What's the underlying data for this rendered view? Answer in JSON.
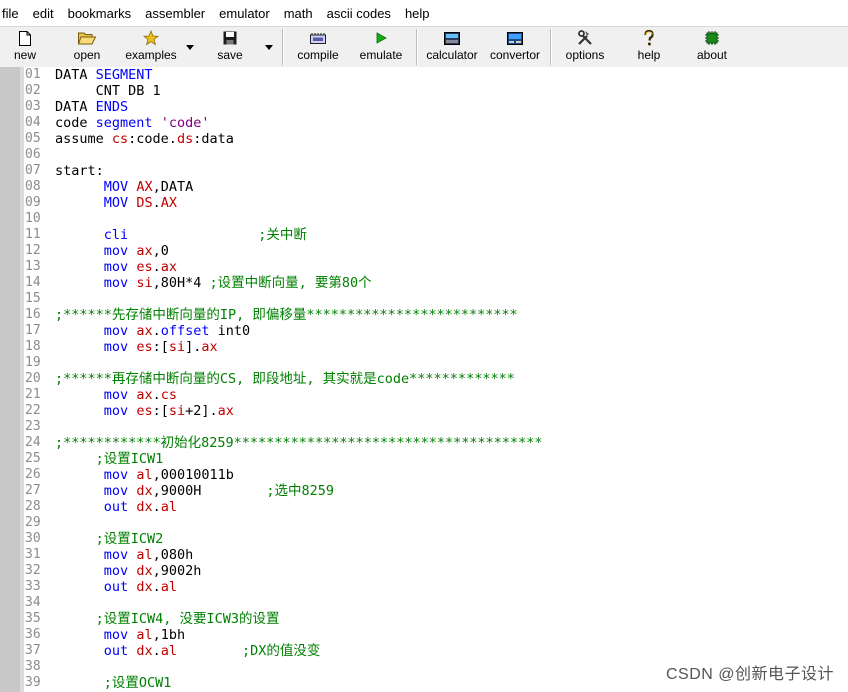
{
  "menu": [
    "file",
    "edit",
    "bookmarks",
    "assembler",
    "emulator",
    "math",
    "ascii codes",
    "help"
  ],
  "toolbar": {
    "new": "new",
    "open": "open",
    "examples": "examples",
    "save": "save",
    "compile": "compile",
    "emulate": "emulate",
    "calculator": "calculator",
    "convertor": "convertor",
    "options": "options",
    "help": "help",
    "about": "about"
  },
  "line_numbers": [
    "01",
    "02",
    "03",
    "04",
    "05",
    "06",
    "07",
    "08",
    "09",
    "10",
    "11",
    "12",
    "13",
    "14",
    "15",
    "16",
    "17",
    "18",
    "19",
    "20",
    "21",
    "22",
    "23",
    "24",
    "25",
    "26",
    "27",
    "28",
    "29",
    "30",
    "31",
    "32",
    "33",
    "34",
    "35",
    "36",
    "37",
    "38",
    "39"
  ],
  "code_lines": [
    [
      [
        "t",
        "DATA "
      ],
      [
        "k",
        "SEGMENT"
      ]
    ],
    [
      [
        "t",
        "     CNT DB 1"
      ]
    ],
    [
      [
        "t",
        "DATA "
      ],
      [
        "k",
        "ENDS"
      ]
    ],
    [
      [
        "t",
        "code "
      ],
      [
        "k",
        "segment"
      ],
      [
        "t",
        " "
      ],
      [
        "s",
        "'code'"
      ]
    ],
    [
      [
        "t",
        "assume "
      ],
      [
        "r",
        "cs"
      ],
      [
        "t",
        ":code."
      ],
      [
        "r",
        "ds"
      ],
      [
        "t",
        ":data"
      ]
    ],
    [],
    [
      [
        "t",
        "start:"
      ]
    ],
    [
      [
        "t",
        "      "
      ],
      [
        "k",
        "MOV"
      ],
      [
        "t",
        " "
      ],
      [
        "r",
        "AX"
      ],
      [
        "t",
        ",DATA"
      ]
    ],
    [
      [
        "t",
        "      "
      ],
      [
        "k",
        "MOV"
      ],
      [
        "t",
        " "
      ],
      [
        "r",
        "DS"
      ],
      [
        "t",
        "."
      ],
      [
        "r",
        "AX"
      ]
    ],
    [],
    [
      [
        "t",
        "      "
      ],
      [
        "k",
        "cli"
      ],
      [
        "t",
        "                "
      ],
      [
        "c",
        ";关中断"
      ]
    ],
    [
      [
        "t",
        "      "
      ],
      [
        "k",
        "mov"
      ],
      [
        "t",
        " "
      ],
      [
        "r",
        "ax"
      ],
      [
        "t",
        ",0"
      ]
    ],
    [
      [
        "t",
        "      "
      ],
      [
        "k",
        "mov"
      ],
      [
        "t",
        " "
      ],
      [
        "r",
        "es"
      ],
      [
        "t",
        "."
      ],
      [
        "r",
        "ax"
      ]
    ],
    [
      [
        "t",
        "      "
      ],
      [
        "k",
        "mov"
      ],
      [
        "t",
        " "
      ],
      [
        "r",
        "si"
      ],
      [
        "t",
        ",80H*4 "
      ],
      [
        "c",
        ";设置中断向量, 要第80个"
      ]
    ],
    [],
    [
      [
        "c",
        ";******先存储中断向量的IP, 即偏移量**************************"
      ]
    ],
    [
      [
        "t",
        "      "
      ],
      [
        "k",
        "mov"
      ],
      [
        "t",
        " "
      ],
      [
        "r",
        "ax"
      ],
      [
        "t",
        "."
      ],
      [
        "k",
        "offset"
      ],
      [
        "t",
        " int0"
      ]
    ],
    [
      [
        "t",
        "      "
      ],
      [
        "k",
        "mov"
      ],
      [
        "t",
        " "
      ],
      [
        "r",
        "es"
      ],
      [
        "t",
        ":["
      ],
      [
        "r",
        "si"
      ],
      [
        "t",
        "]."
      ],
      [
        "r",
        "ax"
      ]
    ],
    [],
    [
      [
        "c",
        ";******再存储中断向量的CS, 即段地址, 其实就是code*************"
      ]
    ],
    [
      [
        "t",
        "      "
      ],
      [
        "k",
        "mov"
      ],
      [
        "t",
        " "
      ],
      [
        "r",
        "ax"
      ],
      [
        "t",
        "."
      ],
      [
        "r",
        "cs"
      ]
    ],
    [
      [
        "t",
        "      "
      ],
      [
        "k",
        "mov"
      ],
      [
        "t",
        " "
      ],
      [
        "r",
        "es"
      ],
      [
        "t",
        ":["
      ],
      [
        "r",
        "si"
      ],
      [
        "t",
        "+2]."
      ],
      [
        "r",
        "ax"
      ]
    ],
    [],
    [
      [
        "c",
        ";************初始化8259**************************************"
      ]
    ],
    [
      [
        "t",
        "     "
      ],
      [
        "c",
        ";设置ICW1"
      ]
    ],
    [
      [
        "t",
        "      "
      ],
      [
        "k",
        "mov"
      ],
      [
        "t",
        " "
      ],
      [
        "r",
        "al"
      ],
      [
        "t",
        ",00010011b"
      ]
    ],
    [
      [
        "t",
        "      "
      ],
      [
        "k",
        "mov"
      ],
      [
        "t",
        " "
      ],
      [
        "r",
        "dx"
      ],
      [
        "t",
        ",9000H        "
      ],
      [
        "c",
        ";选中8259"
      ]
    ],
    [
      [
        "t",
        "      "
      ],
      [
        "k",
        "out"
      ],
      [
        "t",
        " "
      ],
      [
        "r",
        "dx"
      ],
      [
        "t",
        "."
      ],
      [
        "r",
        "al"
      ]
    ],
    [],
    [
      [
        "t",
        "     "
      ],
      [
        "c",
        ";设置ICW2"
      ]
    ],
    [
      [
        "t",
        "      "
      ],
      [
        "k",
        "mov"
      ],
      [
        "t",
        " "
      ],
      [
        "r",
        "al"
      ],
      [
        "t",
        ",080h"
      ]
    ],
    [
      [
        "t",
        "      "
      ],
      [
        "k",
        "mov"
      ],
      [
        "t",
        " "
      ],
      [
        "r",
        "dx"
      ],
      [
        "t",
        ",9002h"
      ]
    ],
    [
      [
        "t",
        "      "
      ],
      [
        "k",
        "out"
      ],
      [
        "t",
        " "
      ],
      [
        "r",
        "dx"
      ],
      [
        "t",
        "."
      ],
      [
        "r",
        "al"
      ]
    ],
    [],
    [
      [
        "t",
        "     "
      ],
      [
        "c",
        ";设置ICW4, 没要ICW3的设置"
      ]
    ],
    [
      [
        "t",
        "      "
      ],
      [
        "k",
        "mov"
      ],
      [
        "t",
        " "
      ],
      [
        "r",
        "al"
      ],
      [
        "t",
        ",1bh"
      ]
    ],
    [
      [
        "t",
        "      "
      ],
      [
        "k",
        "out"
      ],
      [
        "t",
        " "
      ],
      [
        "r",
        "dx"
      ],
      [
        "t",
        "."
      ],
      [
        "r",
        "al"
      ],
      [
        "t",
        "        "
      ],
      [
        "c",
        ";DX的值没变"
      ]
    ],
    [],
    [
      [
        "t",
        "      "
      ],
      [
        "c",
        ";设置OCW1"
      ]
    ]
  ],
  "watermark": "CSDN @创新电子设计",
  "colors": {
    "keyword": "#0000ff",
    "register": "#c00000",
    "comment": "#008000",
    "string": "#800080",
    "gutter": "#c8c8c8"
  }
}
